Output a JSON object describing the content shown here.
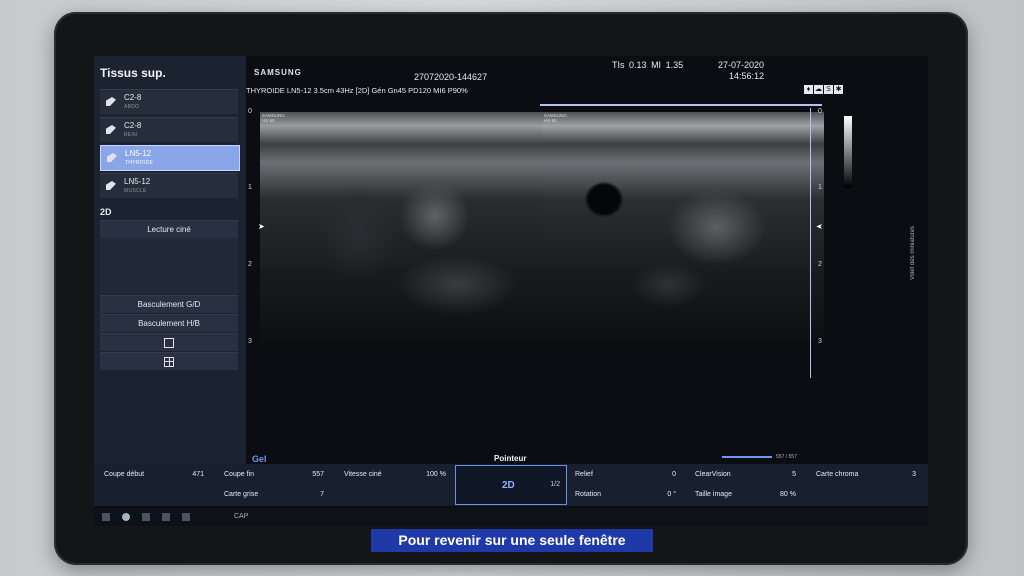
{
  "left_panel": {
    "title": "Tissus sup.",
    "probes": [
      {
        "name": "C2-8",
        "sub": "ABDO"
      },
      {
        "name": "C2-8",
        "sub": "REIN"
      },
      {
        "name": "LN5-12",
        "sub": "THYROIDE",
        "active": true
      },
      {
        "name": "LN5-12",
        "sub": "MUSCLE"
      }
    ],
    "mode": "2D",
    "cine_button": "Lecture ciné",
    "flip_lr": "Basculement G/D",
    "flip_ud": "Basculement H/B"
  },
  "header": {
    "brand": "SAMSUNG",
    "patient_id": "27072020-144627",
    "params": "THYROIDE LN5-12 3.5cm 43Hz [2D] Gén Gn45 PD120 MI6 P90%",
    "tis_label": "TIs",
    "tis_value": "0.13",
    "mi_label": "MI",
    "mi_value": "1.35",
    "date": "27-07-2020",
    "time": "14:56:12",
    "image_tag_brand": "SAMSUNG",
    "image_tag_model": "HS 50"
  },
  "image": {
    "depth_ticks": [
      "0",
      "1",
      "2",
      "3"
    ],
    "gel_label": "Gel",
    "cine_counter": "557 / 557",
    "sidebar_label": "Volet des miniatures",
    "pointer_label": "Pointeur"
  },
  "controls": {
    "coupe_debut": {
      "label": "Coupe début",
      "value": "471"
    },
    "coupe_fin": {
      "label": "Coupe fin",
      "value": "557"
    },
    "vitesse_cine": {
      "label": "Vitesse ciné",
      "value": "100 %"
    },
    "carte_grise": {
      "label": "Carte grise",
      "value": "7"
    },
    "mode_2d": "2D",
    "page": "1/2",
    "relief": {
      "label": "Relief",
      "value": "0"
    },
    "rotation": {
      "label": "Rotation",
      "value": "0 °"
    },
    "clearvision": {
      "label": "ClearVision",
      "value": "5"
    },
    "taille_image": {
      "label": "Taille image",
      "value": "80 %"
    },
    "carte_chroma": {
      "label": "Carte chroma",
      "value": "3"
    }
  },
  "status": {
    "cap": "CAP"
  },
  "caption": "Pour revenir sur une seule fenêtre"
}
